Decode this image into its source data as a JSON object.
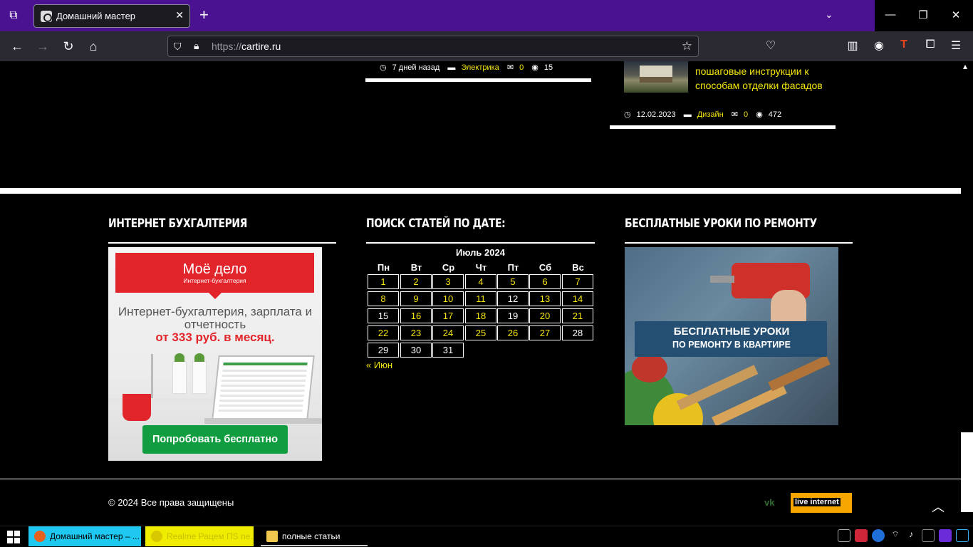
{
  "browser": {
    "tab": {
      "title": "Домашний мастер"
    },
    "url": {
      "scheme": "https://",
      "host": "cartire.ru"
    }
  },
  "posts": [
    {
      "date": "7 дней назад",
      "category": "Электрика",
      "comments": "0",
      "views": "15"
    },
    {
      "title": "пошаговые инструкции к способам отделки фасадов",
      "date": "12.02.2023",
      "category": "Дизайн",
      "comments": "0",
      "views": "472"
    }
  ],
  "widgets": {
    "accounting": {
      "title": "Интернет бухгалтерия",
      "ad": {
        "logo": "Моё дело",
        "logo_sub": "Интернет-бухгалтерия",
        "line1": "Интернет-бухгалтерия, зарплата и отчетность",
        "line2": "от 333 руб. в месяц.",
        "cta": "Попробовать бесплатно"
      }
    },
    "calendar": {
      "title": "Поиск статей по дате:",
      "caption": "Июль 2024",
      "weekdays": [
        "Пн",
        "Вт",
        "Ср",
        "Чт",
        "Пт",
        "Сб",
        "Вс"
      ],
      "days": [
        {
          "d": "1",
          "link": true
        },
        {
          "d": "2",
          "link": true
        },
        {
          "d": "3",
          "link": true
        },
        {
          "d": "4",
          "link": true
        },
        {
          "d": "5",
          "link": true
        },
        {
          "d": "6",
          "link": true
        },
        {
          "d": "7",
          "link": true
        },
        {
          "d": "8",
          "link": true
        },
        {
          "d": "9",
          "link": true
        },
        {
          "d": "10",
          "link": true
        },
        {
          "d": "11",
          "link": true
        },
        {
          "d": "12",
          "link": false
        },
        {
          "d": "13",
          "link": true
        },
        {
          "d": "14",
          "link": true
        },
        {
          "d": "15",
          "link": false
        },
        {
          "d": "16",
          "link": true
        },
        {
          "d": "17",
          "link": true
        },
        {
          "d": "18",
          "link": true
        },
        {
          "d": "19",
          "link": false
        },
        {
          "d": "20",
          "link": true
        },
        {
          "d": "21",
          "link": true
        },
        {
          "d": "22",
          "link": true
        },
        {
          "d": "23",
          "link": true
        },
        {
          "d": "24",
          "link": true
        },
        {
          "d": "25",
          "link": true
        },
        {
          "d": "26",
          "link": true
        },
        {
          "d": "27",
          "link": true
        },
        {
          "d": "28",
          "link": false
        },
        {
          "d": "29",
          "link": false
        },
        {
          "d": "30",
          "link": false
        },
        {
          "d": "31",
          "link": false
        }
      ],
      "prev": "« Июн"
    },
    "repair": {
      "title": "Бесплатные уроки по ремонту",
      "banner_line1": "БЕСПЛАТНЫЕ УРОКИ",
      "banner_line2": "ПО РЕМОНТУ В КВАРТИРЕ"
    }
  },
  "footer": {
    "copyright": "© 2024 Все права защищены",
    "counter_label": "live internet"
  },
  "taskbar": {
    "items": [
      {
        "label": "Домашний мастер – ..."
      },
      {
        "label": "Realme Рацем ПЅ ne..."
      },
      {
        "label": "полные статьи"
      }
    ]
  },
  "colors": {
    "accent": "#f5e50e",
    "tabbar": "#4a1190",
    "ad_red": "#e2252b",
    "ad_green": "#0f9d3f"
  }
}
